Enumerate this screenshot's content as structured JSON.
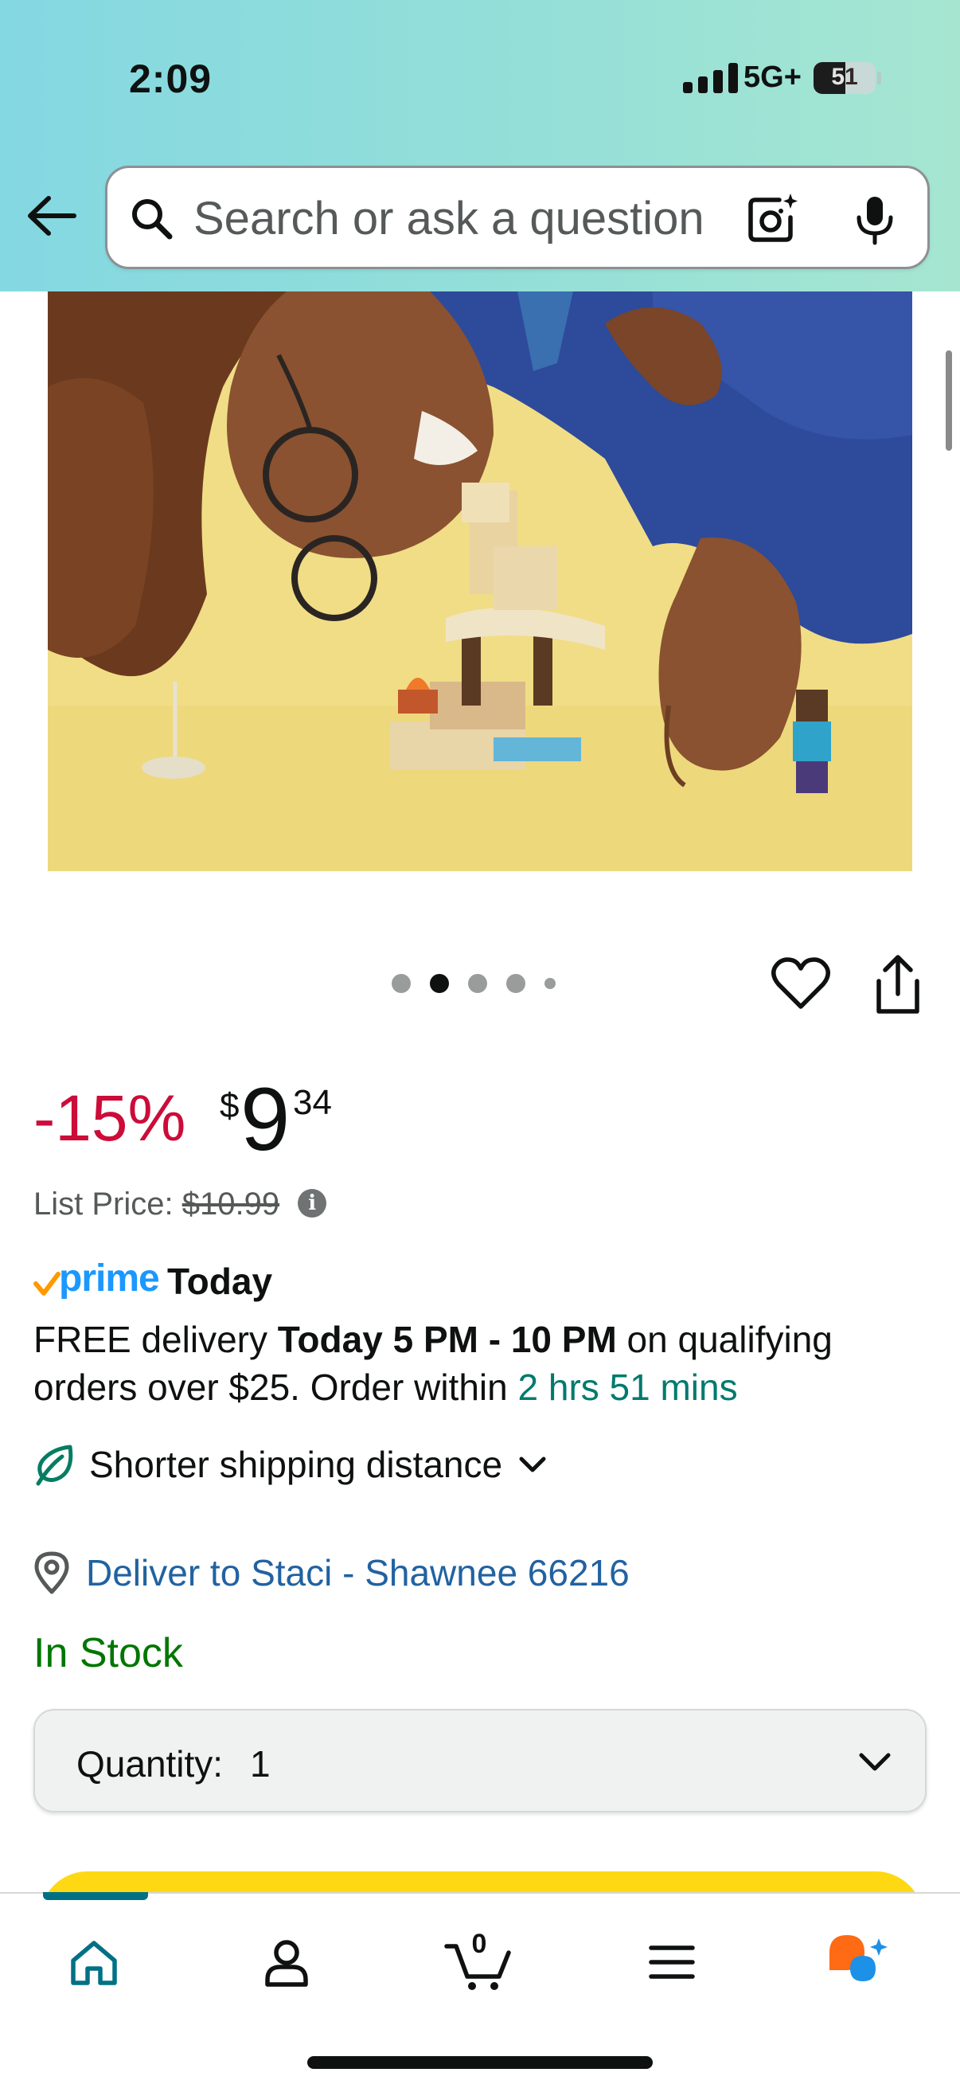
{
  "status_bar": {
    "time": "2:09",
    "network": "5G+",
    "battery": "51",
    "battery_level": 0.51
  },
  "header": {
    "search_placeholder": "Search or ask a question",
    "icons": [
      "back-arrow-icon",
      "search-icon",
      "camera-lens-icon",
      "microphone-icon"
    ]
  },
  "gallery": {
    "image_count": 5,
    "active_index": 1,
    "icons": [
      "heart-icon",
      "share-icon"
    ]
  },
  "price": {
    "discount": "-15%",
    "currency": "$",
    "whole": "9",
    "fraction": "34",
    "list_price_label": "List Price:",
    "list_price_value": "$10.99",
    "info_icon_glyph": "i"
  },
  "prime": {
    "brand": "prime",
    "today": "Today"
  },
  "delivery": {
    "prefix": "FREE delivery ",
    "window": "Today 5 PM - 10 PM",
    "middle": " on qualifying orders over $25. Order within ",
    "countdown": "2 hrs 51 mins"
  },
  "shipping": {
    "label": "Shorter shipping distance"
  },
  "deliver_to": {
    "label": "Deliver to Staci - Shawnee 66216"
  },
  "stock": {
    "status": "In Stock"
  },
  "quantity": {
    "label": "Quantity:",
    "value": "1"
  },
  "tabbar": {
    "tabs": [
      "home",
      "account",
      "cart",
      "menu",
      "rufus"
    ],
    "cart_count": "0",
    "active_tab": "home"
  },
  "colors": {
    "accent_teal": "#007185",
    "discount_red": "#cc0c39",
    "link_blue": "#2162a1",
    "in_stock_green": "#007600",
    "countdown_green": "#007a6e",
    "prime_blue": "#1a98ff",
    "prime_orange": "#ff9900",
    "add_to_cart_yellow": "#ffd814"
  }
}
